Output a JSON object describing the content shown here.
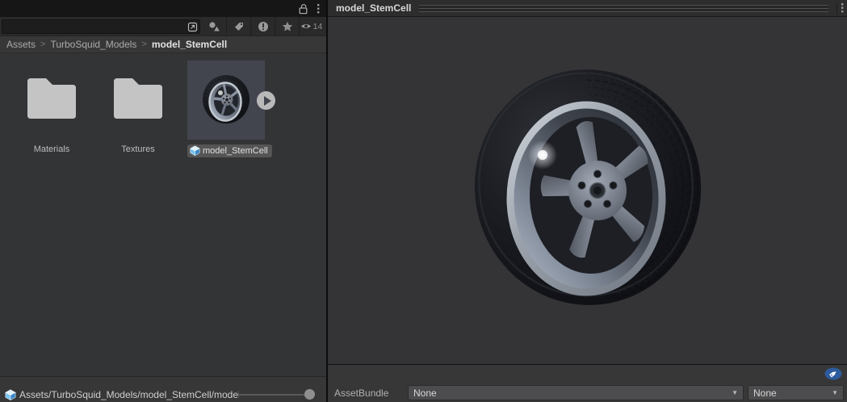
{
  "left_panel": {
    "toolbar": {
      "visible_count": "14"
    },
    "breadcrumb": {
      "items": [
        "Assets",
        "TurboSquid_Models",
        "model_StemCell"
      ],
      "separator": ">"
    },
    "grid_items": [
      {
        "label": "Materials",
        "type": "folder"
      },
      {
        "label": "Textures",
        "type": "folder"
      },
      {
        "label": "model_StemCell",
        "type": "prefab",
        "selected": true
      }
    ],
    "status_path": "Assets/TurboSquid_Models/model_StemCell/model_Ste"
  },
  "preview": {
    "title": "model_StemCell",
    "assetbundle": {
      "label": "AssetBundle",
      "bundle_value": "None",
      "variant_value": "None"
    }
  },
  "colors": {
    "selection_tile": "#43454e",
    "assetbundle_tag_blue": "#2d5c9e",
    "prefab_icon_blue": "#79c3ef",
    "panel_dark": "#333436"
  }
}
